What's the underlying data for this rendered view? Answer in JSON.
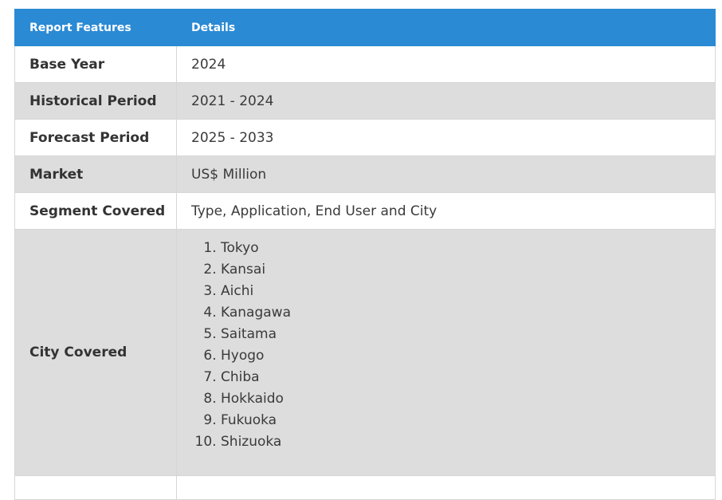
{
  "table": {
    "header": {
      "feature": "Report Features",
      "details": "Details"
    },
    "rows": [
      {
        "feature": "Base Year",
        "details": "2024"
      },
      {
        "feature": "Historical Period",
        "details": "2021 - 2024"
      },
      {
        "feature": "Forecast Period",
        "details": "2025 - 2033"
      },
      {
        "feature": "Market",
        "details": "US$ Million"
      },
      {
        "feature": "Segment Covered",
        "details": "Type, Application, End User and City"
      }
    ],
    "city_row": {
      "feature": "City Covered",
      "cities": [
        "Tokyo",
        "Kansai",
        "Aichi",
        "Kanagawa",
        "Saitama",
        "Hyogo",
        "Chiba",
        "Hokkaido",
        "Fukuoka",
        "Shizuoka"
      ]
    }
  },
  "colors": {
    "header_bg": "#2b8ad4",
    "row_alt_bg": "#dddddd",
    "border": "#d6d6d6"
  }
}
